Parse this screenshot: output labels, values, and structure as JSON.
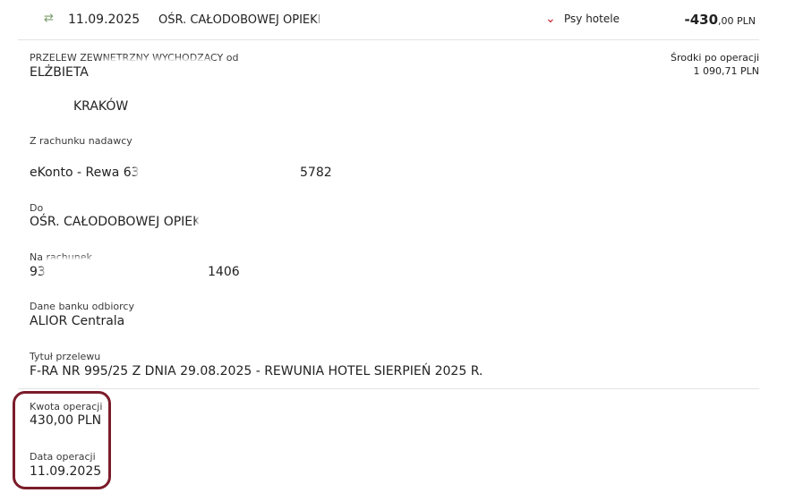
{
  "transaction": {
    "date": "11.09.2025",
    "payee": "OŚR. CAŁODOBOWEJ OPIEKI",
    "category": "Psy hotele",
    "amount_main": "-430",
    "amount_frac": ",00 PLN"
  },
  "details": {
    "type_label": "PRZELEW ZEWNĘTRZNY WYCHODZĄCY od",
    "sender_name": "ELŻBIETA",
    "sender_city": "KRAKÓW",
    "balance_label": "Środki po operacji",
    "balance_value": "1 090,71 PLN",
    "from_account_label": "Z rachunku nadawcy",
    "from_account_name": "eKonto - Rewa 63",
    "from_account_suffix": "5782",
    "to_label": "Do",
    "to_value": "OŚR. CAŁODOBOWEJ OPIEKI",
    "to_account_label": "Na rachunek",
    "to_account_prefix": "93",
    "to_account_suffix": "1406",
    "bank_label": "Dane banku odbiorcy",
    "bank_value": "ALIOR Centrala",
    "title_label": "Tytuł przelewu",
    "title_value": "F-RA NR 995/25 Z DNIA 29.08.2025 - REWUNIA HOTEL SIERPIEŃ 2025 R.",
    "amount_label": "Kwota operacji",
    "amount_value": "430,00 PLN",
    "op_date_label": "Data operacji",
    "op_date_value": "11.09.2025"
  },
  "colors": {
    "accent_red": "#c8202f",
    "highlight_border": "#7b1c2a",
    "transfer_icon": "#7a9c6a"
  },
  "icons": {
    "transfer": "transfer-arrows-icon",
    "category": "chevron-down-icon"
  }
}
